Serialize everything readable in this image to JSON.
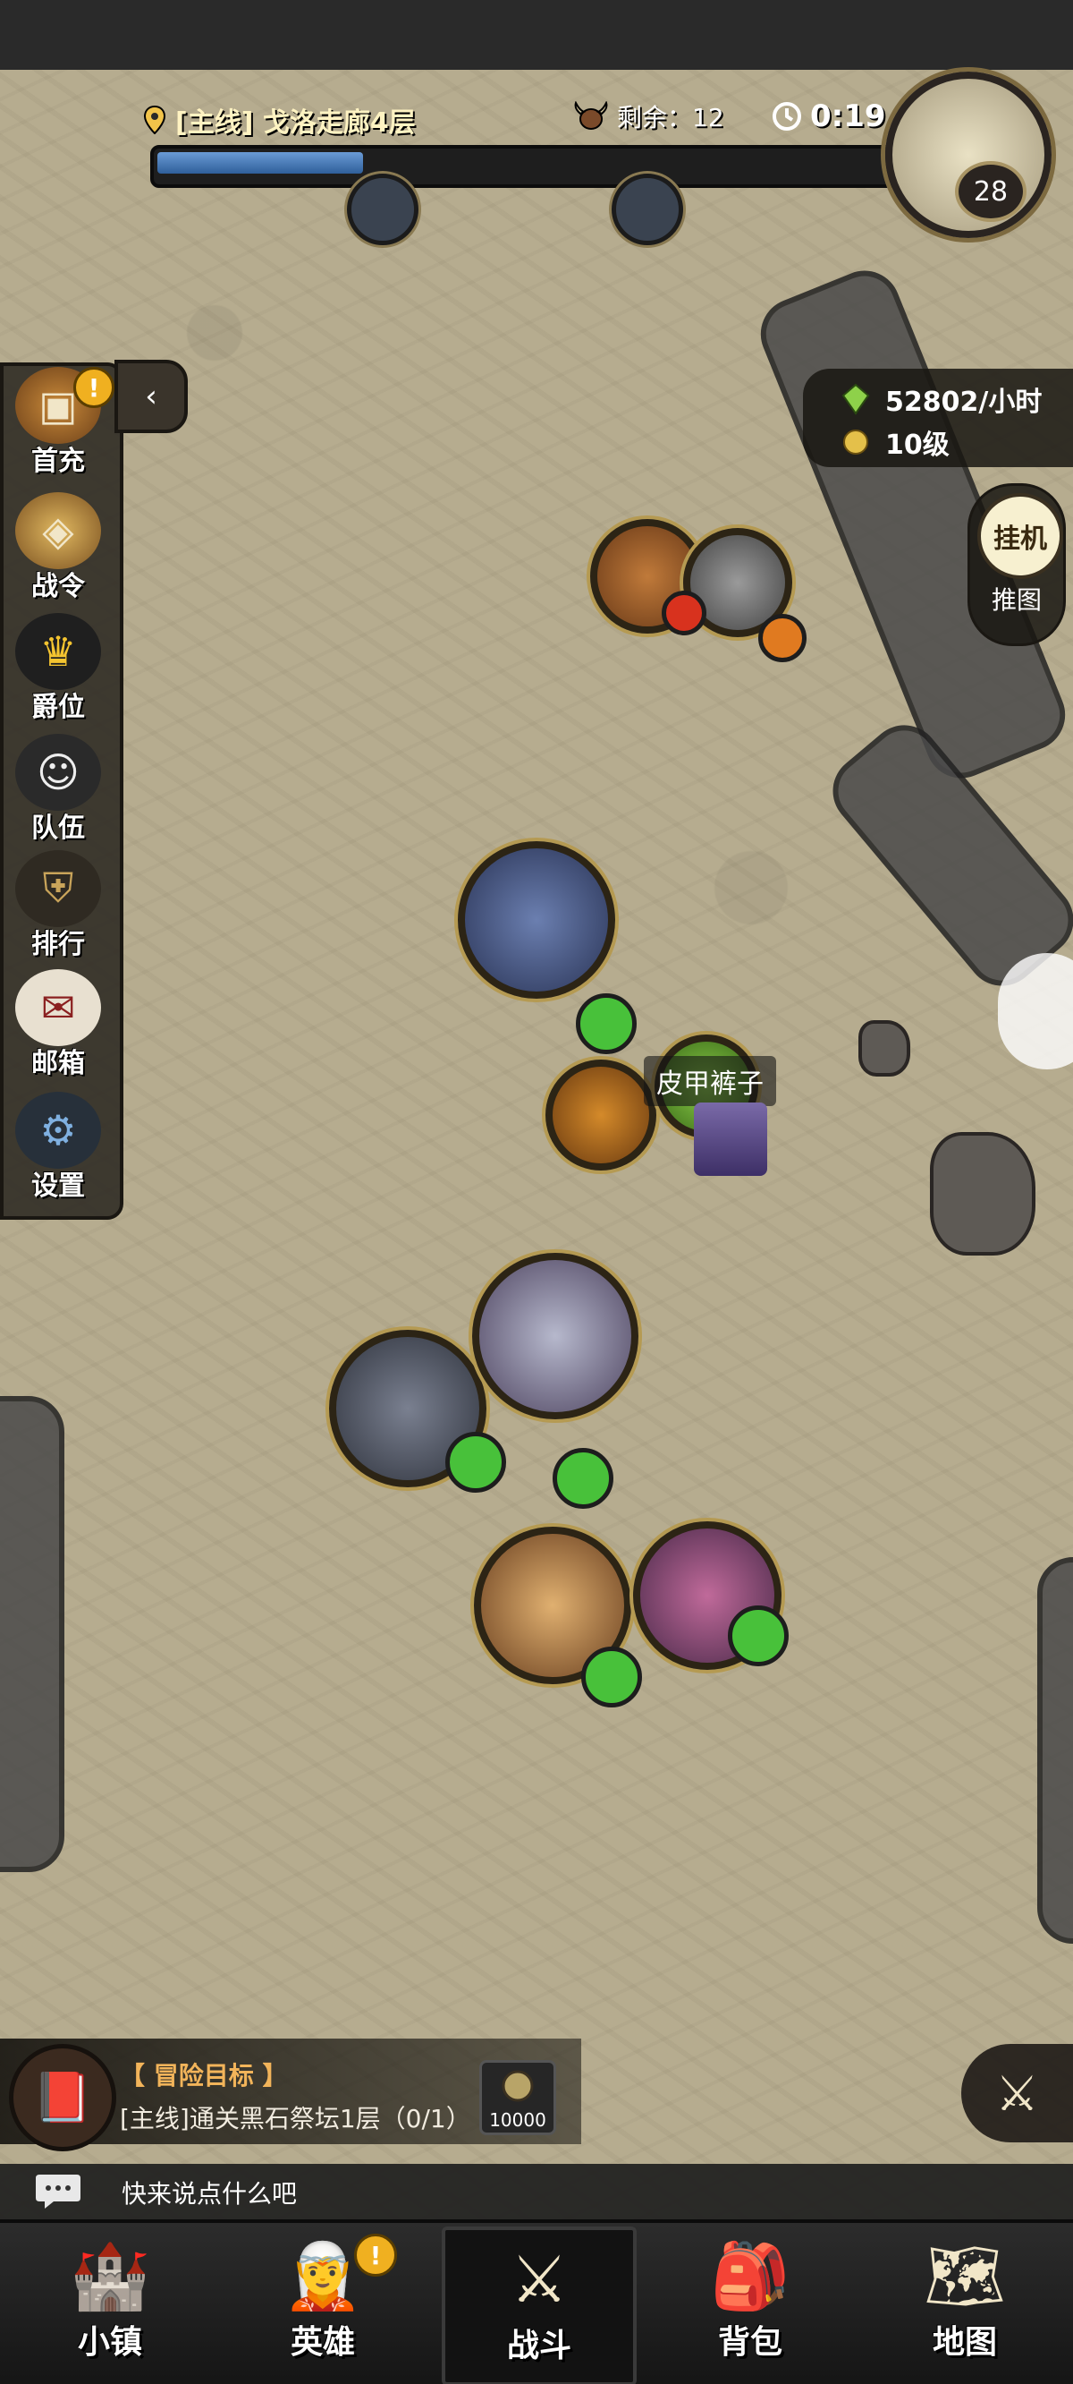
{
  "hud": {
    "quest_label": "[主线] 戈洛走廊4层",
    "remaining_label": "剩余：12",
    "timer": "0:19",
    "player_level": "28",
    "progress_fraction": 0.28
  },
  "left_menu": {
    "toggle_icon": "collapse-arrow-icon",
    "alert": "!",
    "items": [
      {
        "label": "首充",
        "icon": "treasure-chest-icon"
      },
      {
        "label": "战令",
        "icon": "battle-pass-crest-icon"
      },
      {
        "label": "爵位",
        "icon": "crown-icon"
      },
      {
        "label": "队伍",
        "icon": "team-faces-icon"
      },
      {
        "label": "排行",
        "icon": "ranking-shield-icon"
      },
      {
        "label": "邮箱",
        "icon": "mail-envelope-icon"
      },
      {
        "label": "设置",
        "icon": "gear-icon"
      }
    ]
  },
  "income": {
    "rate": "52802/小时",
    "level": "10级"
  },
  "idle": {
    "idle_label": "挂机",
    "push_label": "推图"
  },
  "battlefield": {
    "drop_item_label": "皮甲裤子"
  },
  "adventure_goal": {
    "title": "【 冒险目标 】",
    "description": "[主线]通关黑石祭坛1层（0/1）",
    "reward_amount": "10000"
  },
  "chat": {
    "placeholder": "快来说点什么吧"
  },
  "bottom_nav": {
    "alert": "!",
    "items": [
      {
        "label": "小镇",
        "icon": "town-icon",
        "active": false
      },
      {
        "label": "英雄",
        "icon": "hero-portrait-icon",
        "active": false
      },
      {
        "label": "战斗",
        "icon": "crossed-swords-icon",
        "active": true
      },
      {
        "label": "背包",
        "icon": "backpack-icon",
        "active": false
      },
      {
        "label": "地图",
        "icon": "map-scroll-icon",
        "active": false
      }
    ]
  },
  "colors": {
    "map_ground": "#b6ac8f",
    "hp_green": "#48c13a",
    "accent_gold": "#b59a52",
    "goal_title": "#f2b45a"
  }
}
